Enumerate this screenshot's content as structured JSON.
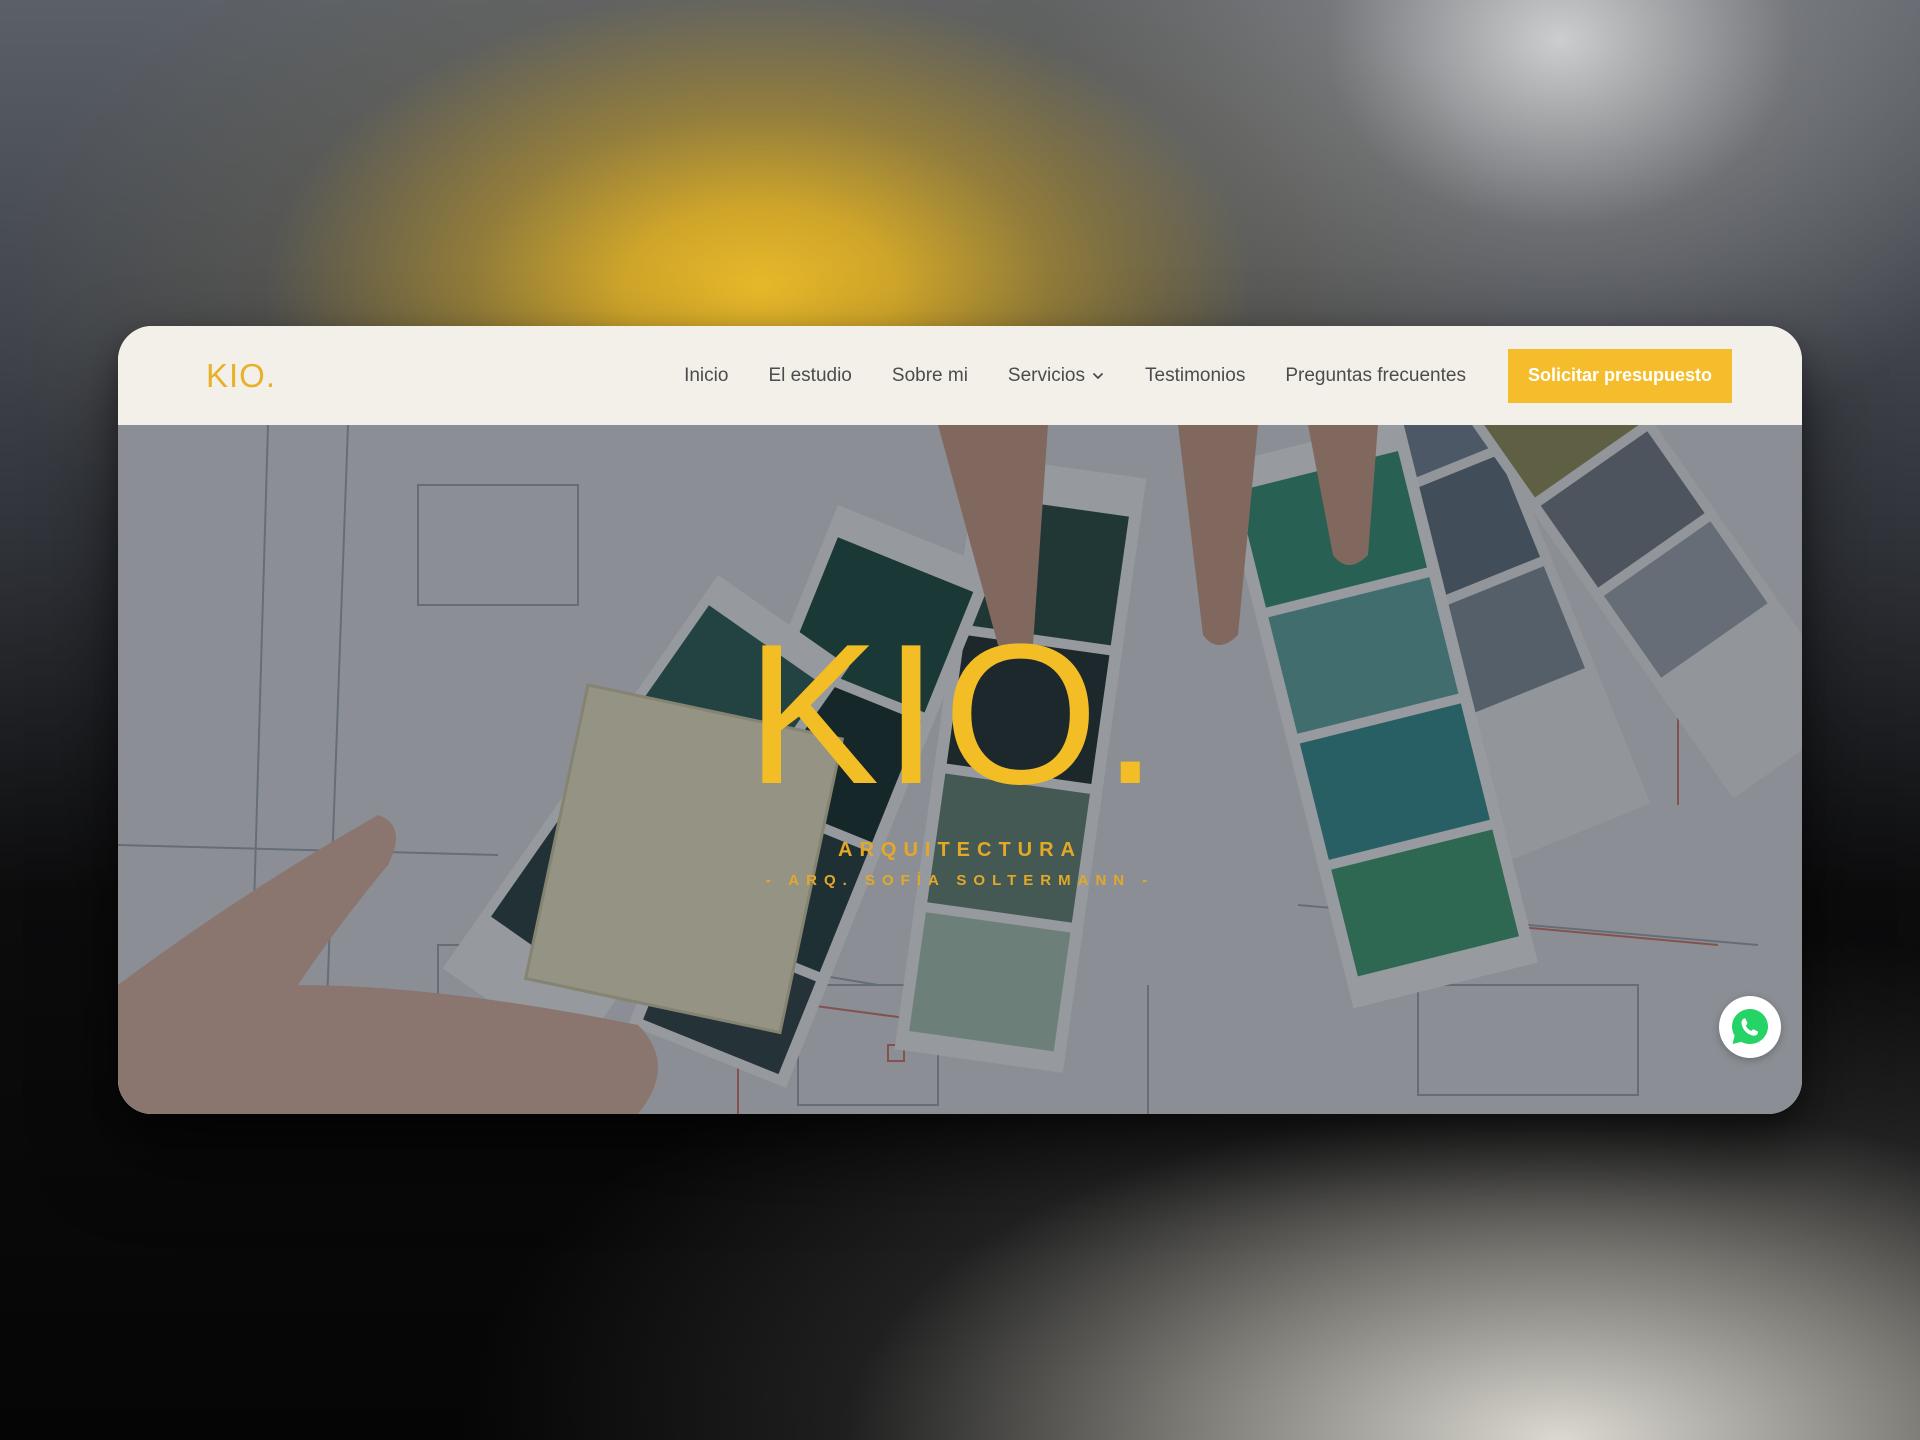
{
  "navbar": {
    "logo": "KIO.",
    "links": [
      {
        "label": "Inicio"
      },
      {
        "label": "El estudio"
      },
      {
        "label": "Sobre mi"
      },
      {
        "label": "Servicios"
      },
      {
        "label": "Testimonios"
      },
      {
        "label": "Preguntas frecuentes"
      }
    ],
    "cta_label": "Solicitar presupuesto"
  },
  "hero": {
    "title": "KIO.",
    "subtitle": "ARQUITECTURA",
    "tagline": "- ARQ. SOFÍA SOLTERMANN -"
  },
  "colors": {
    "accent": "#f5bd2b",
    "nav_background": "#f3f0ea",
    "nav_text": "#4c4c4c",
    "whatsapp_green": "#25d366"
  },
  "icons": {
    "dropdown": "chevron-down-icon",
    "chat": "whatsapp-icon"
  }
}
